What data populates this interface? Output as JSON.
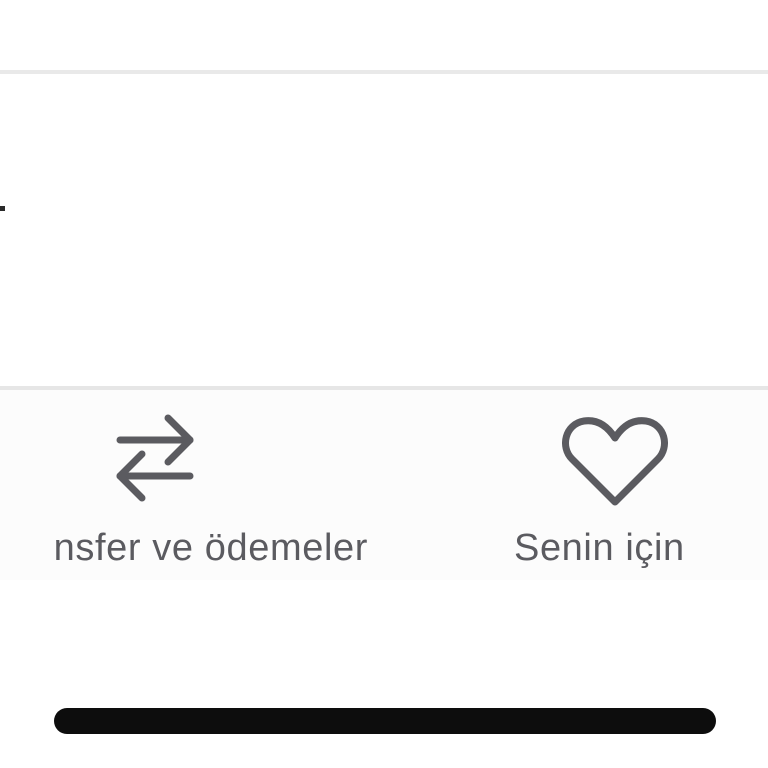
{
  "tab_bar": {
    "tabs": [
      {
        "label": "nsfer ve ödemeler",
        "icon": "transfer-arrows-icon"
      },
      {
        "label": "Senin için",
        "icon": "heart-icon"
      }
    ]
  },
  "colors": {
    "tab_text": "#5b5b60",
    "divider": "#e6e6e6",
    "home_indicator": "#0d0d0d"
  }
}
